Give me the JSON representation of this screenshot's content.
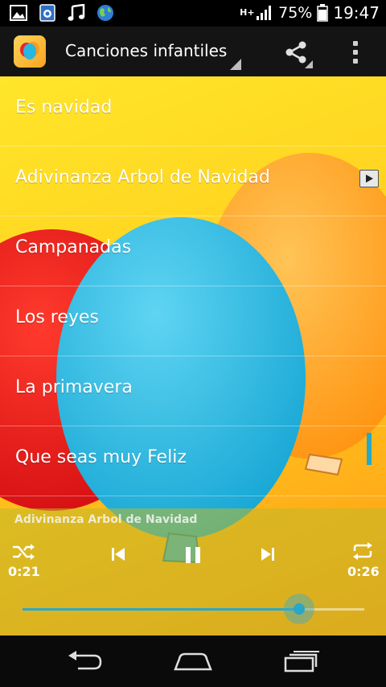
{
  "status_bar": {
    "icons": [
      "gallery-icon",
      "photo-icon",
      "music-note-icon",
      "globe-icon"
    ],
    "network": "H+",
    "battery_percent": "75%",
    "time": "19:47"
  },
  "action_bar": {
    "title": "Canciones infantiles",
    "share_icon": "share-icon",
    "overflow_icon": "overflow-menu-icon"
  },
  "songs": [
    {
      "label": "Es navidad"
    },
    {
      "label": "Adivinanza Arbol de Navidad"
    },
    {
      "label": "Campanadas"
    },
    {
      "label": "Los reyes"
    },
    {
      "label": "La primavera"
    },
    {
      "label": "Que seas muy Feliz"
    }
  ],
  "now_playing_index": 1,
  "player": {
    "now_playing": "Adivinanza Arbol de Navidad",
    "elapsed": "0:21",
    "total": "0:26",
    "progress": 0.81,
    "controls": [
      "shuffle-icon",
      "previous-icon",
      "pause-icon",
      "next-icon",
      "repeat-icon"
    ]
  },
  "nav_bar": {
    "buttons": [
      "back-icon",
      "home-icon",
      "recent-apps-icon"
    ]
  },
  "colors": {
    "accent": "#2aa6c6",
    "background_yellow": "#ffd21f",
    "balloon_blue": "#22b0da",
    "balloon_red": "#e81a1a",
    "balloon_orange": "#ff9b1a"
  }
}
